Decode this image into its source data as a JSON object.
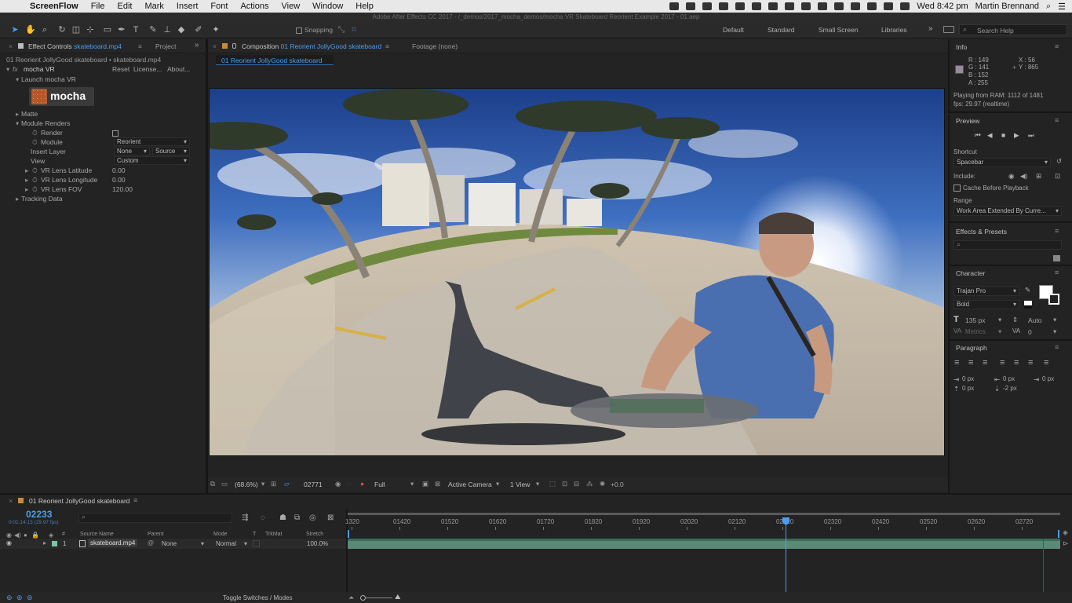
{
  "menubar": {
    "app": "ScreenFlow",
    "items": [
      "File",
      "Edit",
      "Mark",
      "Insert",
      "Font",
      "Actions",
      "View",
      "Window",
      "Help"
    ],
    "clock": "Wed 8:42 pm",
    "user": "Martin Brennand"
  },
  "window_title": "Adobe After Effects CC 2017 - /_demos/2017_mocha_demos/mocha VR Skateboard Reorient Example 2017 - 01.aep",
  "toolbar": {
    "snapping": "Snapping",
    "workspaces": [
      "Default",
      "Standard",
      "Small Screen",
      "Libraries"
    ],
    "search_placeholder": "Search Help"
  },
  "effect_controls": {
    "tab_prefix": "Effect Controls",
    "tab_file": "skateboard.mp4",
    "project_tab": "Project",
    "layer_path": "01 Reorient JollyGood skateboard • skateboard.mp4",
    "effect_name": "mocha VR",
    "reset": "Reset",
    "license": "License...",
    "about": "About...",
    "launch": "Launch mocha VR",
    "logo": "mocha",
    "matte": "Matte",
    "module_renders": "Module Renders",
    "render_label": "Render",
    "module_label": "Module",
    "module_value": "Reorient",
    "insert_layer_label": "Insert Layer",
    "insert_layer_value": "None",
    "insert_layer_source": "Source",
    "view_label": "View",
    "view_value": "Custom",
    "lat_label": "VR Lens Latitude",
    "lat_value": "0.00",
    "lon_label": "VR Lens Longitude",
    "lon_value": "0.00",
    "fov_label": "VR Lens FOV",
    "fov_value": "120.00",
    "tracking_data": "Tracking Data"
  },
  "composition": {
    "tab_prefix": "Composition",
    "tab_name": "01 Reorient JollyGood skateboard",
    "footage_tab": "Footage (none)",
    "breadcrumb": "01 Reorient JollyGood skateboard"
  },
  "viewer_bar": {
    "zoom": "(68.6%)",
    "timecode": "02771",
    "resolution": "Full",
    "camera": "Active Camera",
    "views": "1 View",
    "exposure": "+0.0"
  },
  "info": {
    "title": "Info",
    "r": "R : 149",
    "g": "G : 141",
    "b": "B : 152",
    "a": "A : 255",
    "x": "X : 56",
    "y": "Y : 865",
    "playing": "Playing from RAM: 1112 of 1481",
    "fps": "fps: 29.97 (realtime)",
    "swatch": "#958d98"
  },
  "preview": {
    "title": "Preview",
    "shortcut_label": "Shortcut",
    "shortcut_value": "Spacebar",
    "include_label": "Include:",
    "cache_label": "Cache Before Playback",
    "range_label": "Range",
    "range_value": "Work Area Extended By Curre..."
  },
  "effects_presets": {
    "title": "Effects & Presets"
  },
  "character": {
    "title": "Character",
    "font": "Trajan Pro",
    "style": "Bold",
    "size": "135 px",
    "leading": "Auto",
    "kerning": "Metrics",
    "tracking": "0"
  },
  "paragraph": {
    "title": "Paragraph",
    "indent_left": "0 px",
    "indent_right": "0 px",
    "indent_first": "0 px",
    "space_before": "0 px",
    "space_after": "-2 px"
  },
  "timeline": {
    "tab": "01 Reorient JollyGood skateboard",
    "timecode": "02233",
    "subtime": "0:01:14:13 (29.97 fps)",
    "ruler": [
      "1320",
      "01420",
      "01520",
      "01620",
      "01720",
      "01820",
      "01920",
      "02020",
      "02120",
      "02220",
      "02320",
      "02420",
      "02520",
      "02620",
      "02720"
    ],
    "columns": {
      "source": "Source Name",
      "parent": "Parent",
      "mode": "Mode",
      "trkmat": "TrkMat",
      "stretch": "Stretch"
    },
    "layer": {
      "num": "1",
      "name": "skateboard.mp4",
      "parent": "None",
      "mode": "Normal",
      "stretch": "100.0%"
    },
    "toggle": "Toggle Switches / Modes"
  }
}
